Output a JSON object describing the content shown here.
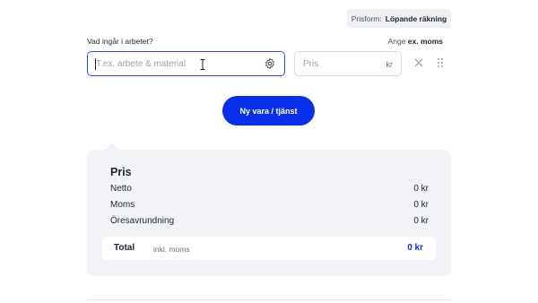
{
  "pricing": {
    "label": "Prisform:",
    "value": "Löpande räkning"
  },
  "form": {
    "question": "Vad ingår i arbetet?",
    "tax_prefix": "Ange",
    "tax_value": "ex. moms",
    "work_placeholder": "T.ex. arbete & material",
    "price_placeholder": "Pris",
    "price_unit": "kr"
  },
  "actions": {
    "new_item_label": "Ny vara / tjänst"
  },
  "summary": {
    "title": "Pris",
    "rows": [
      {
        "label": "Netto",
        "value": "0 kr"
      },
      {
        "label": "Moms",
        "value": "0 kr"
      },
      {
        "label": "Öresavrundning",
        "value": "0 kr"
      }
    ],
    "total": {
      "label": "Total",
      "sub": "inkl. moms",
      "value": "0 kr"
    }
  },
  "colors": {
    "accent": "#0a2fe8",
    "panel": "#f1f3f6",
    "input_focus": "#3b4fd8"
  },
  "icons": [
    "settings-gear-icon",
    "close-icon",
    "drag-handle-icon",
    "text-cursor-icon"
  ]
}
